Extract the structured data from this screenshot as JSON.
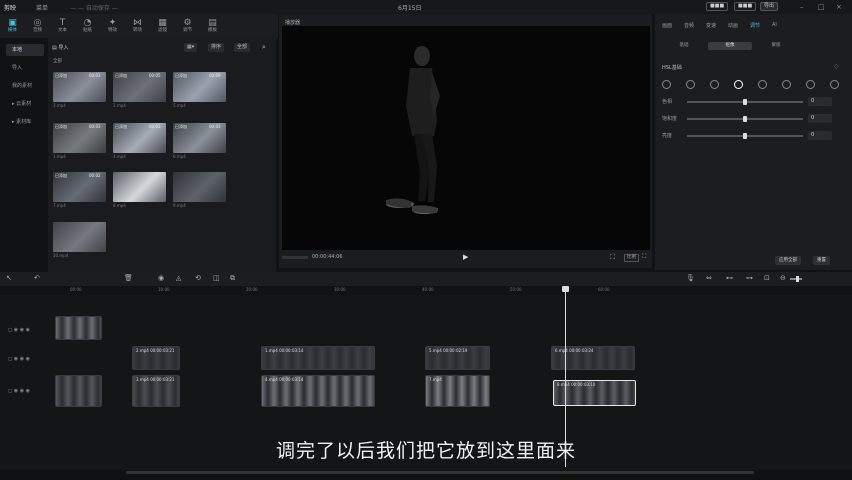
{
  "titlebar": {
    "app": "剪映",
    "menu": "菜单",
    "project": "— — 自动保存 —",
    "date": "6月15日",
    "btn1": "■■■",
    "btn2": "■■■",
    "btn3": "导出"
  },
  "toolbar": [
    {
      "icon": "▣",
      "label": "媒体"
    },
    {
      "icon": "◎",
      "label": "音频"
    },
    {
      "icon": "T",
      "label": "文本"
    },
    {
      "icon": "◔",
      "label": "贴纸"
    },
    {
      "icon": "✦",
      "label": "特效"
    },
    {
      "icon": "⋈",
      "label": "转场"
    },
    {
      "icon": "▦",
      "label": "滤镜"
    },
    {
      "icon": "⚙",
      "label": "调节"
    },
    {
      "icon": "▤",
      "label": "模板"
    }
  ],
  "sidebar": [
    "本地",
    "导入",
    "我的素材",
    "云素材",
    "素材库"
  ],
  "media": {
    "import": "导入",
    "sort": "排序",
    "filter": "全部",
    "section": "全部",
    "items": [
      {
        "tag": "已添加",
        "dur": "00:03"
      },
      {
        "tag": "已添加",
        "dur": "00:05"
      },
      {
        "tag": "已添加",
        "dur": "00:09"
      },
      {
        "tag": "已添加",
        "dur": "00:03"
      },
      {
        "tag": "已添加",
        "dur": "00:03"
      },
      {
        "tag": "已添加",
        "dur": "00:03"
      },
      {
        "tag": "已添加",
        "dur": "00:02"
      },
      {
        "tag": "",
        "dur": ""
      },
      {
        "tag": "",
        "dur": ""
      },
      {
        "tag": "",
        "dur": ""
      }
    ],
    "names": [
      "3.mp4",
      "2.mp4",
      "5.mp4",
      "1.mp4",
      "4.mp4",
      "6.mp4",
      "7.mp4",
      "8.mp4",
      "9.mp4",
      "10.mp4"
    ]
  },
  "player": {
    "title": "播放器",
    "time": "00:00:44:06",
    "fit": "比例",
    "full": "⛶"
  },
  "props": {
    "tabs": [
      "画面",
      "音频",
      "变速",
      "动画",
      "调节",
      "AI"
    ],
    "subtabs": [
      "基础",
      "抠像",
      "蒙版"
    ],
    "section": "HSL基础",
    "sliders": [
      {
        "label": "色相",
        "value": "0"
      },
      {
        "label": "饱和度",
        "value": "0"
      },
      {
        "label": "亮度",
        "value": "0"
      }
    ],
    "btn_apply": "应用全部",
    "btn_reset": "重置",
    "ring_colors": [
      "#e05a5a",
      "#e08a3a",
      "#e0d03a",
      "#6bd04c",
      "#3fc0c0",
      "#4a7be0",
      "#9b5ae0",
      "#e05ab5"
    ]
  },
  "timeline": {
    "ticks": [
      "00:00",
      "10:00",
      "20:00",
      "30:00",
      "40:00",
      "50:00",
      "60:00"
    ],
    "clips": [
      {
        "label": "",
        "row": 0
      },
      {
        "label": "2.mp4  00:00:03:21",
        "row": 1
      },
      {
        "label": "1.mp4  00:00:03:14",
        "row": 1
      },
      {
        "label": "5.mp4  00:00:02:19",
        "row": 1
      },
      {
        "label": "6.mp4  00:00:03:24",
        "row": 1
      },
      {
        "label": "",
        "row": 2
      },
      {
        "label": "3.mp4  00:00:03:21",
        "row": 2
      },
      {
        "label": "4.mp4  00:00:03:14",
        "row": 2
      },
      {
        "label": "7.mp4",
        "row": 2
      },
      {
        "label": "8.mp4  00:00:03:10",
        "row": 2
      }
    ]
  },
  "subtitle": "调完了以后我们把它放到这里面来"
}
